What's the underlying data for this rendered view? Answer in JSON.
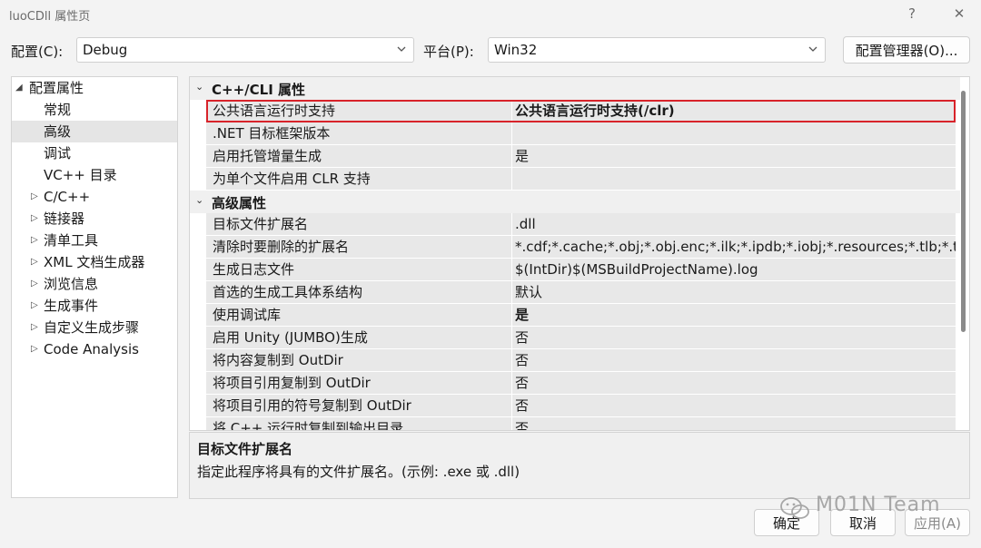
{
  "window": {
    "title": "luoCDll 属性页"
  },
  "titlebar": {
    "help": "?",
    "close": "✕"
  },
  "toolbar": {
    "config_label": "配置(C):",
    "config_value": "Debug",
    "platform_label": "平台(P):",
    "platform_value": "Win32",
    "config_manager": "配置管理器(O)..."
  },
  "tree": {
    "root": "配置属性",
    "items": [
      "常规",
      "高级",
      "调试",
      "VC++ 目录",
      "C/C++",
      "链接器",
      "清单工具",
      "XML 文档生成器",
      "浏览信息",
      "生成事件",
      "自定义生成步骤",
      "Code Analysis"
    ]
  },
  "grid": {
    "category1": "C++/CLI 属性",
    "rows1": [
      {
        "name": "公共语言运行时支持",
        "value": "公共语言运行时支持(/clr)"
      },
      {
        "name": ".NET 目标框架版本",
        "value": ""
      },
      {
        "name": "启用托管增量生成",
        "value": "是"
      },
      {
        "name": "为单个文件启用 CLR 支持",
        "value": ""
      }
    ],
    "category2": "高级属性",
    "rows2": [
      {
        "name": "目标文件扩展名",
        "value": ".dll"
      },
      {
        "name": "清除时要删除的扩展名",
        "value": "*.cdf;*.cache;*.obj;*.obj.enc;*.ilk;*.ipdb;*.iobj;*.resources;*.tlb;*.tli;"
      },
      {
        "name": "生成日志文件",
        "value": "$(IntDir)$(MSBuildProjectName).log"
      },
      {
        "name": "首选的生成工具体系结构",
        "value": "默认"
      },
      {
        "name": "使用调试库",
        "value": "是"
      },
      {
        "name": "启用 Unity (JUMBO)生成",
        "value": "否"
      },
      {
        "name": "将内容复制到 OutDir",
        "value": "否"
      },
      {
        "name": "将项目引用复制到 OutDir",
        "value": "否"
      },
      {
        "name": "将项目引用的符号复制到 OutDir",
        "value": "否"
      },
      {
        "name": "将 C++ 运行时复制到输出目录",
        "value": "否"
      }
    ]
  },
  "description": {
    "title": "目标文件扩展名",
    "body": "指定此程序将具有的文件扩展名。(示例: .exe 或 .dll)"
  },
  "buttons": {
    "ok": "确定",
    "cancel": "取消",
    "apply": "应用(A)"
  },
  "watermark": {
    "text": "M01N Team"
  },
  "colors": {
    "highlight": "#d8232a",
    "selected": "#e5e5e5"
  }
}
